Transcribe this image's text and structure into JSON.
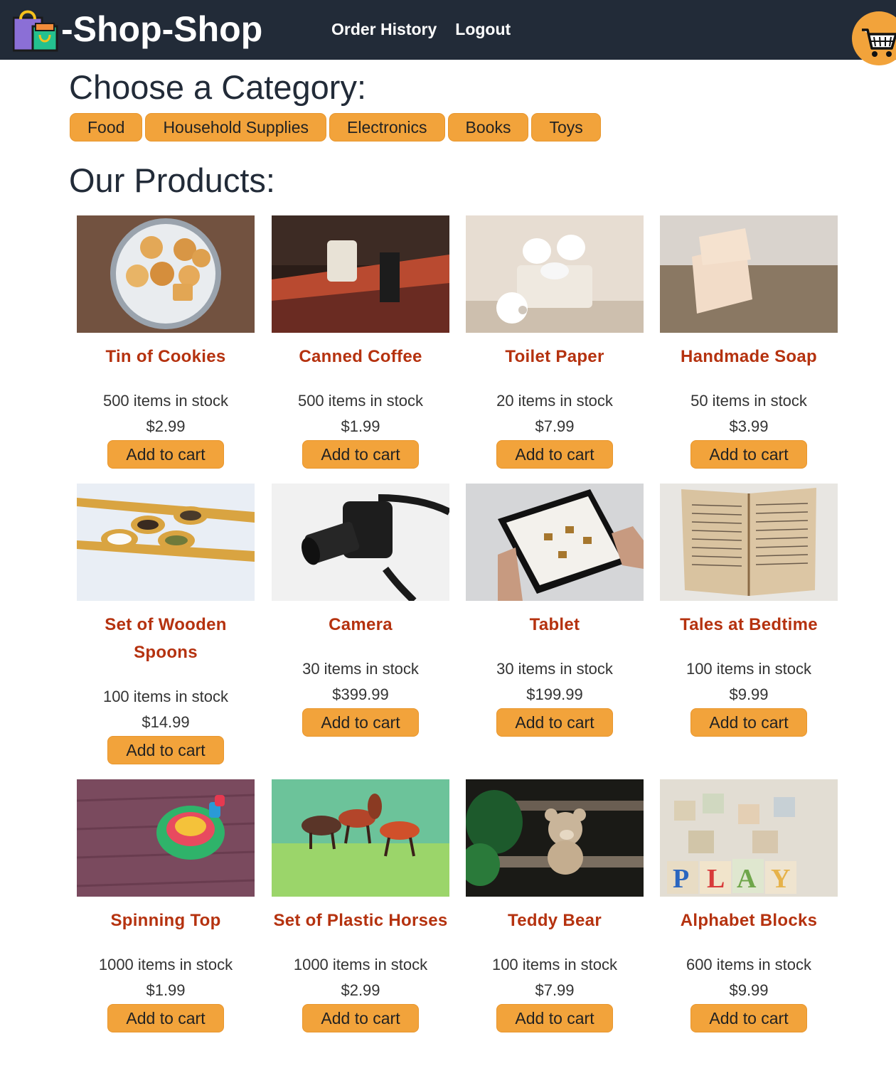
{
  "navbar": {
    "brand": "-Shop-Shop",
    "links": [
      "Order History",
      "Logout"
    ]
  },
  "categories_heading": "Choose a Category:",
  "categories": [
    "Food",
    "Household Supplies",
    "Electronics",
    "Books",
    "Toys"
  ],
  "products_heading": "Our Products:",
  "add_label": "Add to cart",
  "products": [
    {
      "name": "Tin of Cookies",
      "stock": "500 items in stock",
      "price": "$2.99"
    },
    {
      "name": "Canned Coffee",
      "stock": "500 items in stock",
      "price": "$1.99"
    },
    {
      "name": "Toilet Paper",
      "stock": "20 items in stock",
      "price": "$7.99"
    },
    {
      "name": "Handmade Soap",
      "stock": "50 items in stock",
      "price": "$3.99"
    },
    {
      "name": "Set of Wooden Spoons",
      "stock": "100 items in stock",
      "price": "$14.99"
    },
    {
      "name": "Camera",
      "stock": "30 items in stock",
      "price": "$399.99"
    },
    {
      "name": "Tablet",
      "stock": "30 items in stock",
      "price": "$199.99"
    },
    {
      "name": "Tales at Bedtime",
      "stock": "100 items in stock",
      "price": "$9.99"
    },
    {
      "name": "Spinning Top",
      "stock": "1000 items in stock",
      "price": "$1.99"
    },
    {
      "name": "Set of Plastic Horses",
      "stock": "1000 items in stock",
      "price": "$2.99"
    },
    {
      "name": "Teddy Bear",
      "stock": "100 items in stock",
      "price": "$7.99"
    },
    {
      "name": "Alphabet Blocks",
      "stock": "600 items in stock",
      "price": "$9.99"
    }
  ],
  "icons": {
    "logo": "shopping-bag-icon",
    "cart": "shopping-cart-icon"
  },
  "colors": {
    "navbar": "#222b38",
    "accent": "#f2a33b",
    "product_name": "#b5320f"
  }
}
